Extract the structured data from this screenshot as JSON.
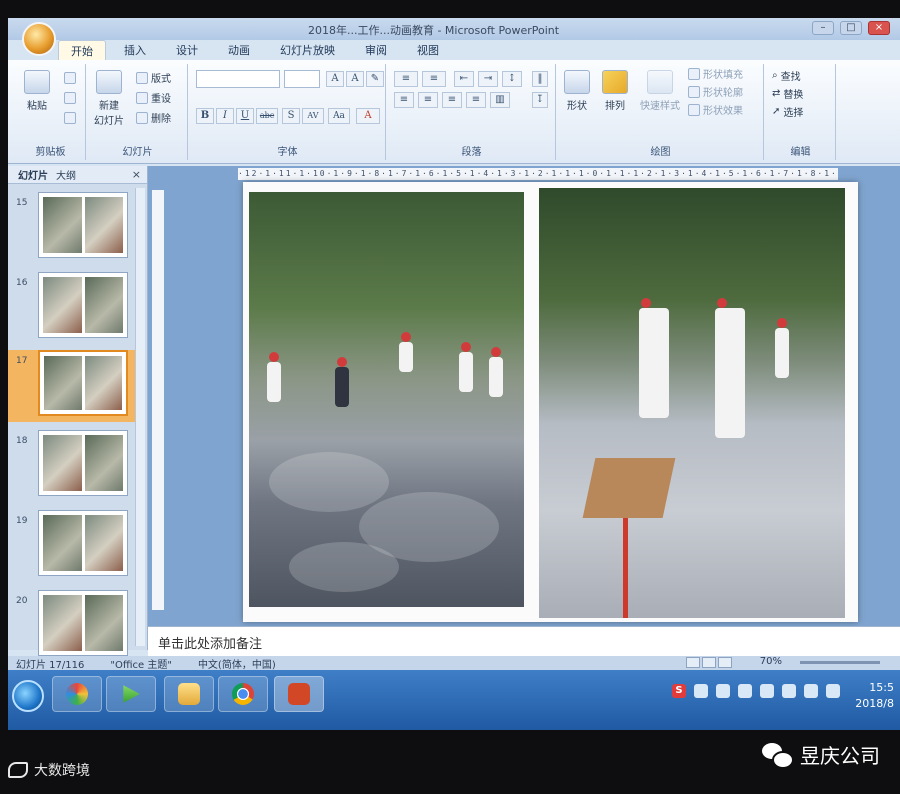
{
  "window": {
    "title": "2018年...工作...动画教育 - Microsoft PowerPoint"
  },
  "ribbon": {
    "tabs": [
      "开始",
      "插入",
      "设计",
      "动画",
      "幻灯片放映",
      "审阅",
      "视图"
    ],
    "active_tab": "开始",
    "clipboard": {
      "paste": "粘贴",
      "label": "剪贴板"
    },
    "slides_group": {
      "new_slide": "新建\n幻灯片",
      "layout": "版式",
      "reset": "重设",
      "delete": "删除",
      "label": "幻灯片"
    },
    "font_group": {
      "label": "字体",
      "buttons": [
        "B",
        "I",
        "U",
        "abc",
        "S",
        "AV",
        "Aa",
        "A"
      ]
    },
    "paragraph_group": {
      "label": "段落"
    },
    "drawing_group": {
      "shape": "形状",
      "arrange": "排列",
      "quick_styles": "快速样式",
      "fill": "形状填充",
      "outline": "形状轮廓",
      "effects": "形状效果",
      "label": "绘图"
    },
    "editing_group": {
      "find": "查找",
      "replace": "替换",
      "select": "选择",
      "label": "编辑"
    }
  },
  "slides_pane": {
    "tabs": [
      "幻灯片",
      "大纲"
    ],
    "close": "×",
    "slides": [
      {
        "num": "15"
      },
      {
        "num": "16"
      },
      {
        "num": "17",
        "active": true
      },
      {
        "num": "18"
      },
      {
        "num": "19"
      },
      {
        "num": "20"
      }
    ]
  },
  "ruler": {
    "text": "·12·1·11·1·10·1·9·1·8·1·7·1·6·1·5·1·4·1·3·1·2·1·1·1·0·1·1·1·2·1·3·1·4·1·5·1·6·1·7·1·8·1·9·1·10·1·11·1·12·"
  },
  "notes": {
    "placeholder": "单击此处添加备注"
  },
  "status_bar": {
    "slide_info": "幻灯片 17/116",
    "theme": "\"Office 主题\"",
    "language": "中文(简体，中国)",
    "zoom": "70%"
  },
  "taskbar": {
    "ime": "S",
    "time": "15:5",
    "date": "2018/8"
  },
  "watermark": {
    "left": "大数跨境",
    "right": "昱庆公司"
  }
}
